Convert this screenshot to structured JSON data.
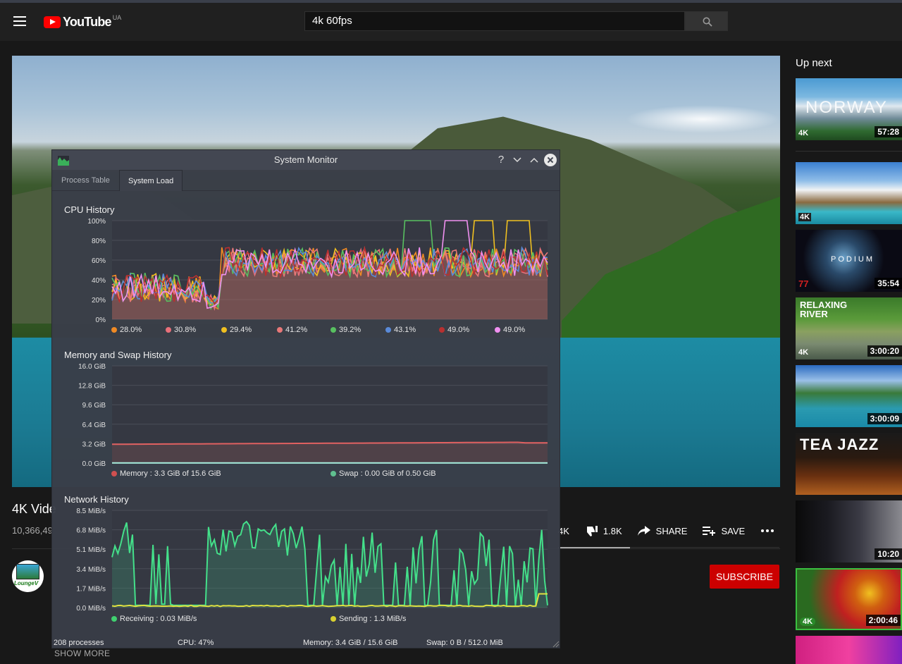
{
  "header": {
    "logo_text": "YouTube",
    "country": "UA",
    "search_value": "4k 60fps"
  },
  "video": {
    "title": "4K Vide",
    "views": "10,366,49",
    "dislike_count": "1.8K",
    "like_count_partial": "4K",
    "share_label": "SHARE",
    "save_label": "SAVE",
    "subscribe_label": "SUBSCRIBE",
    "show_more_label": "SHOW MORE",
    "channel_avatar_text": "LoungeV"
  },
  "sidebar": {
    "heading": "Up next",
    "items": [
      {
        "title": "NORWAY",
        "duration": "57:28",
        "badge": "4K"
      },
      {
        "title": "",
        "duration": "",
        "badge": "4K"
      },
      {
        "title": "PODIUM",
        "duration": "35:54",
        "badge": "77"
      },
      {
        "title": "RELAXING RIVER",
        "duration": "3:00:20",
        "badge": "4K"
      },
      {
        "title": "",
        "duration": "3:00:09",
        "badge": ""
      },
      {
        "title": "TEA JAZZ",
        "duration": "",
        "badge": ""
      },
      {
        "title": "",
        "duration": "10:20",
        "badge": ""
      },
      {
        "title": "",
        "duration": "2:00:46",
        "badge": "4K"
      }
    ]
  },
  "sysmon": {
    "title": "System Monitor",
    "tabs": [
      "Process Table",
      "System Load"
    ],
    "active_tab": "System Load",
    "cpu": {
      "title": "CPU History",
      "y_ticks": [
        "100%",
        "80%",
        "60%",
        "40%",
        "20%",
        "0%"
      ],
      "legend": [
        {
          "label": "28.0%",
          "color": "#f08a24"
        },
        {
          "label": "30.8%",
          "color": "#e8707a"
        },
        {
          "label": "29.4%",
          "color": "#f0c020"
        },
        {
          "label": "41.2%",
          "color": "#e87878"
        },
        {
          "label": "39.2%",
          "color": "#58c060"
        },
        {
          "label": "43.1%",
          "color": "#5a8ad8"
        },
        {
          "label": "49.0%",
          "color": "#b83030"
        },
        {
          "label": "49.0%",
          "color": "#f090f0"
        }
      ]
    },
    "memory": {
      "title": "Memory and Swap History",
      "y_ticks": [
        "16.0 GiB",
        "12.8 GiB",
        "9.6 GiB",
        "6.4 GiB",
        "3.2 GiB",
        "0.0 GiB"
      ],
      "legend": [
        {
          "label": "Memory : 3.3 GiB of 15.6 GiB",
          "color": "#d05050"
        },
        {
          "label": "Swap : 0.00 GiB of 0.50 GiB",
          "color": "#60c090"
        }
      ]
    },
    "network": {
      "title": "Network History",
      "y_ticks": [
        "8.5 MiB/s",
        "6.8 MiB/s",
        "5.1 MiB/s",
        "3.4 MiB/s",
        "1.7 MiB/s",
        "0.0 MiB/s"
      ],
      "legend": [
        {
          "label": "Receiving : 0.03 MiB/s",
          "color": "#40d070"
        },
        {
          "label": "Sending : 1.3 MiB/s",
          "color": "#d8d030"
        }
      ]
    },
    "status": {
      "processes": "208 processes",
      "cpu": "CPU: 47%",
      "memory": "Memory: 3.4 GiB / 15.6 GiB",
      "swap": "Swap: 0 B / 512.0 MiB"
    }
  }
}
